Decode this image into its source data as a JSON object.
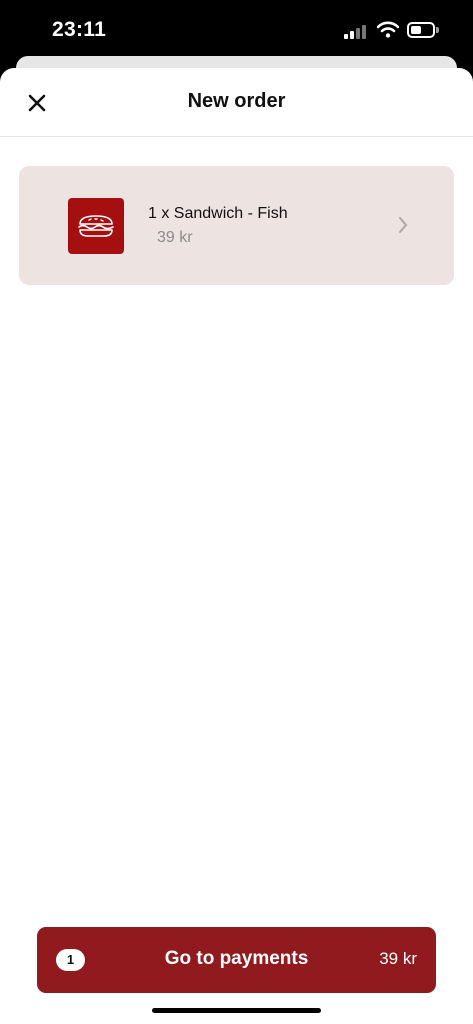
{
  "status_bar": {
    "time": "23:11",
    "signal_icon": "cellular-signal-icon",
    "wifi_icon": "wifi-icon",
    "battery_icon": "battery-icon"
  },
  "header": {
    "title": "New order",
    "close_icon": "close-icon"
  },
  "order_items": [
    {
      "name": "1 x Sandwich - Fish",
      "price": "39 kr",
      "icon": "sandwich-icon",
      "chevron": "chevron-right-icon"
    }
  ],
  "payment_button": {
    "count": "1",
    "label": "Go to payments",
    "total": "39 kr"
  },
  "colors": {
    "accent": "#911a1e",
    "item_thumb": "#a60f0f",
    "card_bg": "#ede3e0"
  }
}
